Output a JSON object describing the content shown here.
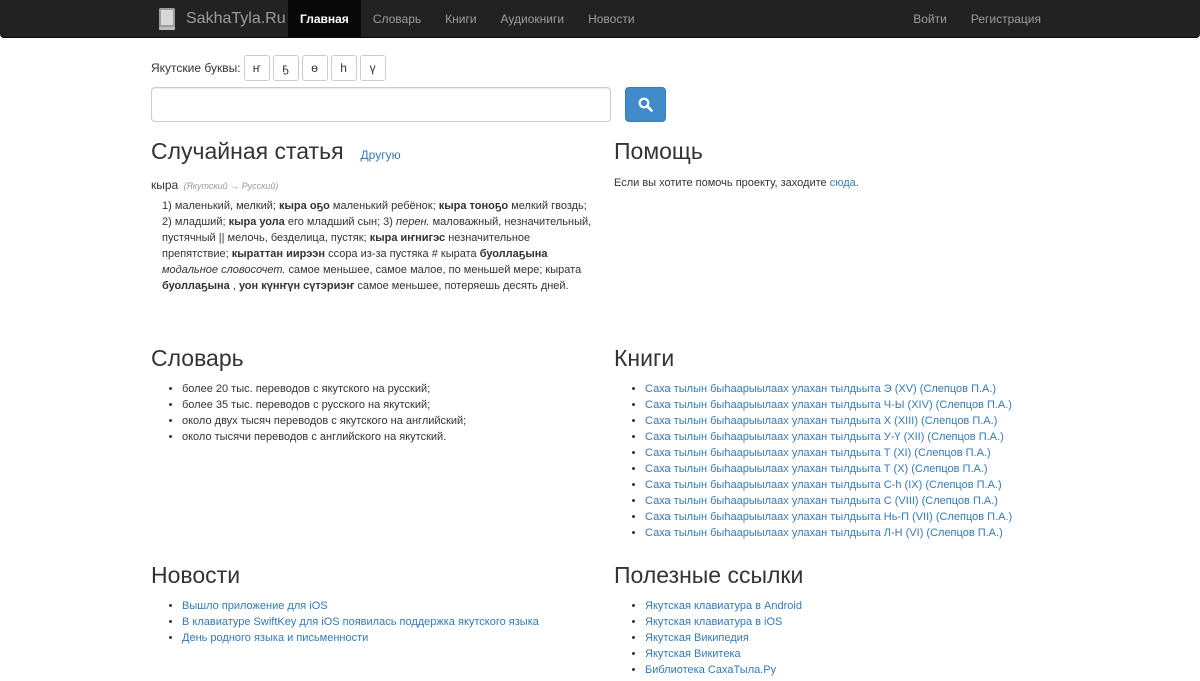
{
  "navbar": {
    "brand": "SakhaTyla.Ru",
    "brand_icon": "book-icon",
    "items": [
      {
        "label": "Главная",
        "active": true
      },
      {
        "label": "Словарь"
      },
      {
        "label": "Книги"
      },
      {
        "label": "Аудиокниги"
      },
      {
        "label": "Новости"
      }
    ],
    "right_items": [
      {
        "label": "Войти"
      },
      {
        "label": "Регистрация"
      }
    ]
  },
  "letters": {
    "label": "Якутские буквы:",
    "buttons": [
      "ҥ",
      "ҕ",
      "ө",
      "һ",
      "ү"
    ]
  },
  "search": {
    "value": "",
    "button_icon": "search-icon"
  },
  "random_article": {
    "title": "Случайная статья",
    "other_link": "Другую",
    "word": "кыра",
    "direction": "(Якутский → Русский)",
    "definition": [
      {
        "t": "1) маленький, мелкий; "
      },
      {
        "t": "кыра оҕо",
        "b": true
      },
      {
        "t": " маленький ребёнок; "
      },
      {
        "t": "кыра тоноҕо",
        "b": true
      },
      {
        "t": " мелкий гвоздь; 2) младший; "
      },
      {
        "t": "кыра уола",
        "b": true
      },
      {
        "t": " его младший сын; 3) "
      },
      {
        "t": "перен.",
        "i": true
      },
      {
        "t": " маловажный, незначительный, пустячный || мелочь, безделица, пустяк; "
      },
      {
        "t": "кыра иҥнигэс",
        "b": true
      },
      {
        "t": " незначительное препятствие; "
      },
      {
        "t": "кыраттан иирээн",
        "b": true
      },
      {
        "t": " ссора из-за пустяка # кырата "
      },
      {
        "t": "буоллаҕына",
        "b": true
      },
      {
        "t": " "
      },
      {
        "t": "модальное словосочет.",
        "i": true
      },
      {
        "t": " самое меньшее, самое малое, по меньшей мере; кырата "
      },
      {
        "t": "буоллаҕына",
        "b": true
      },
      {
        "t": " , "
      },
      {
        "t": "уон күнҥүн сүтэриэҥ",
        "b": true
      },
      {
        "t": " самое меньшее, потеряешь десять дней."
      }
    ]
  },
  "help": {
    "title": "Помощь",
    "text": "Если вы хотите помочь проекту, заходите ",
    "link": "сюда",
    "suffix": "."
  },
  "dictionary": {
    "title": "Словарь",
    "items": [
      "более 20 тыс. переводов с якутского на русский;",
      "более 35 тыс. переводов с русского на якутский;",
      "около двух тысяч переводов с якутского на английский;",
      "около тысячи переводов с английского на якутский."
    ]
  },
  "books": {
    "title": "Книги",
    "items": [
      "Саха тылын быһаарыылаах улахан тылдьыта Э (XV) (Слепцов П.А.)",
      "Саха тылын быһаарыылаах улахан тылдьыта Ч-Ы (XIV) (Слепцов П.А.)",
      "Саха тылын быһаарыылаах улахан тылдьыта Х (XIII) (Слепцов П.А.)",
      "Саха тылын быһаарыылаах улахан тылдьыта У-Ү (XII) (Слепцов П.А.)",
      "Саха тылын быһаарыылаах улахан тылдьыта Т (XI) (Слепцов П.А.)",
      "Саха тылын быһаарыылаах улахан тылдьыта Т (X) (Слепцов П.А.)",
      "Саха тылын быһаарыылаах улахан тылдьыта С-һ (IX) (Слепцов П.А.)",
      "Саха тылын быһаарыылаах улахан тылдьыта С (VIII) (Слепцов П.А.)",
      "Саха тылын быһаарыылаах улахан тылдьыта Нь-П (VII) (Слепцов П.А.)",
      "Саха тылын быһаарыылаах улахан тылдьыта Л-Н (VI) (Слепцов П.А.)"
    ]
  },
  "news": {
    "title": "Новости",
    "items": [
      "Вышло приложение для iOS",
      "В клавиатуре SwiftKey для iOS появилась поддержка якутского языка",
      "День родного языка и письменности"
    ]
  },
  "links": {
    "title": "Полезные ссылки",
    "items": [
      "Якутская клавиатура в Android",
      "Якутская клавиатура в iOS",
      "Якутская Википедия",
      "Якутская Викитека",
      "Библиотека СахаТыла.Ру"
    ]
  },
  "colors": {
    "navbar_bg": "#222222",
    "navbar_active_bg": "#080808",
    "link": "#337ab7",
    "primary_button": "#428bca"
  }
}
